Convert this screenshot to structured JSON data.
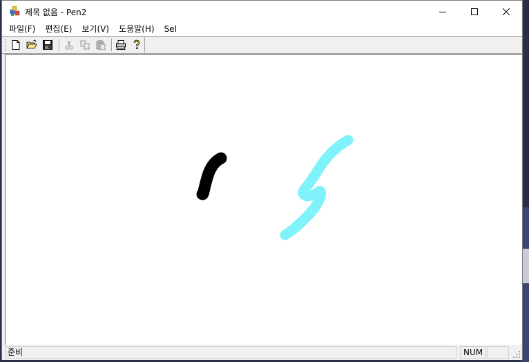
{
  "window": {
    "title": "제목 없음 - Pen2",
    "icon": "app-icon"
  },
  "caption_buttons": {
    "minimize": "minimize-icon",
    "maximize": "maximize-icon",
    "close": "close-icon"
  },
  "menu": {
    "items": [
      {
        "label": "파일(F)"
      },
      {
        "label": "편집(E)"
      },
      {
        "label": "보기(V)"
      },
      {
        "label": "도움말(H)"
      },
      {
        "label": "Sel"
      }
    ]
  },
  "toolbar": {
    "buttons": [
      {
        "icon": "new-file-icon",
        "enabled": true
      },
      {
        "icon": "open-folder-icon",
        "enabled": true
      },
      {
        "icon": "save-icon",
        "enabled": true
      },
      {
        "icon": "cut-icon",
        "enabled": false
      },
      {
        "icon": "copy-icon",
        "enabled": false
      },
      {
        "icon": "paste-icon",
        "enabled": false
      },
      {
        "icon": "print-icon",
        "enabled": true
      },
      {
        "icon": "help-icon",
        "enabled": true
      }
    ]
  },
  "canvas": {
    "strokes": [
      {
        "color": "#000000",
        "name": "black-stroke"
      },
      {
        "color": "#7ff3f9",
        "name": "cyan-stroke"
      }
    ]
  },
  "status": {
    "message": "준비",
    "num": "NUM",
    "caps": ""
  }
}
